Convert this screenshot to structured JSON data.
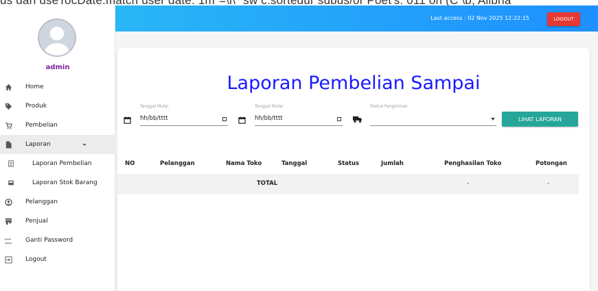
{
  "top_strip": {
    "text": "us dari useTocDate.match user date. 1m\"=\\i\\\" sw c:sortedur subus/or Poet's. 011 on (C \\b, Alibria"
  },
  "user": {
    "name": "admin"
  },
  "sidebar": {
    "items": [
      {
        "label": "Home",
        "icon": "home-icon"
      },
      {
        "label": "Produk",
        "icon": "tag-icon"
      },
      {
        "label": "Pembelian",
        "icon": "cart-icon"
      },
      {
        "label": "Laporan",
        "icon": "file-icon"
      },
      {
        "label": "Laporan Pembelian",
        "icon": "receipt-icon"
      },
      {
        "label": "Laporan Stok Barang",
        "icon": "inbox-icon"
      },
      {
        "label": "Pelanggan",
        "icon": "user-circle-icon"
      },
      {
        "label": "Penjual",
        "icon": "store-icon"
      },
      {
        "label": "Ganti Password",
        "icon": "password-icon"
      },
      {
        "label": "Logout",
        "icon": "logout-icon"
      }
    ]
  },
  "header": {
    "last_access": "Last access : 02 Nov 2025 12:22:15",
    "logout_label": "LOGOUT"
  },
  "report": {
    "title": "Laporan Pembelian Sampai",
    "filters": {
      "start_date_label": "Tanggal Mulai",
      "start_date_value": "hh/bb/tttt",
      "end_date_label": "Tanggal Mulai",
      "end_date_value": "hh/bb/tttt",
      "status_label": "Status Pengiriman",
      "status_value": ""
    },
    "view_button": "LIHAT LAPORAN",
    "columns": [
      "NO",
      "Pelanggan",
      "Nama Toko",
      "Tanggal",
      "Status",
      "Jumlah",
      "Penghasilan Toko",
      "Potongan"
    ],
    "total_label": "TOTAL",
    "total_income": "-",
    "total_discount": "-"
  },
  "colors": {
    "header_gradient_start": "#29b6f6",
    "header_gradient_end": "#1e90ff",
    "title": "#1a1aff",
    "logout_button": "#e53935",
    "view_button": "#26a69a",
    "username": "#7b1fa2"
  }
}
